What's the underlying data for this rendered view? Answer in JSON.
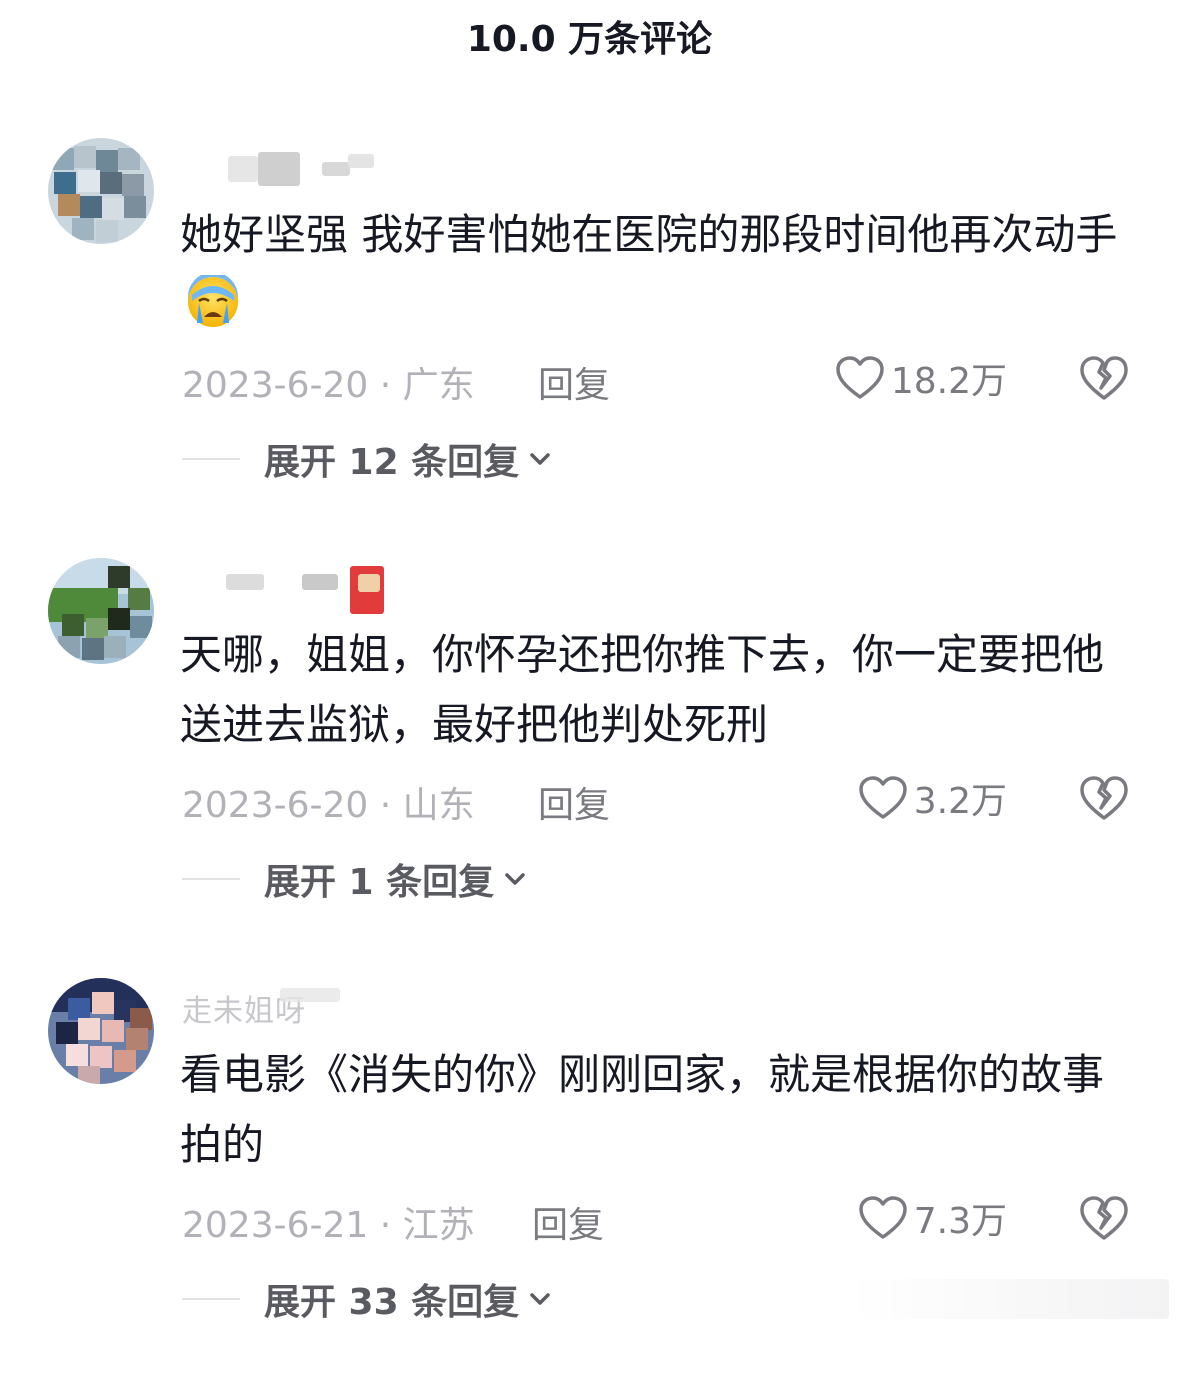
{
  "header": {
    "title": "10.0 万条评论"
  },
  "comments": [
    {
      "username": "",
      "text": "她好坚强 我好害怕她在医院的那段时间他再次动手",
      "emoji": "crying-face",
      "date": "2023-6-20",
      "location": "广东",
      "date_location": "2023-6-20 · 广东",
      "reply_label": "回复",
      "likes": "18.2万",
      "expand_label": "展开 12 条回复"
    },
    {
      "username": "",
      "text": "天哪，姐姐，你怀孕还把你推下去，你一定要把他送进去监狱，最好把他判处死刑",
      "emoji": "",
      "date": "2023-6-20",
      "location": "山东",
      "date_location": "2023-6-20 · 山东",
      "reply_label": "回复",
      "likes": "3.2万",
      "expand_label": "展开 1 条回复"
    },
    {
      "username": "走未姐呀",
      "text": "看电影《消失的你》刚刚回家，就是根据你的故事拍的",
      "emoji": "",
      "date": "2023-6-21",
      "location": "江苏",
      "date_location": "2023-6-21 · 江苏",
      "reply_label": "回复",
      "likes": "7.3万",
      "expand_label": "展开 33 条回复"
    }
  ],
  "colors": {
    "text": "#161823",
    "meta": "#b1b1b7",
    "secondary": "#7a7b80"
  },
  "icons": [
    "heart-icon",
    "broken-heart-icon",
    "chevron-down-icon",
    "crying-face-emoji"
  ]
}
